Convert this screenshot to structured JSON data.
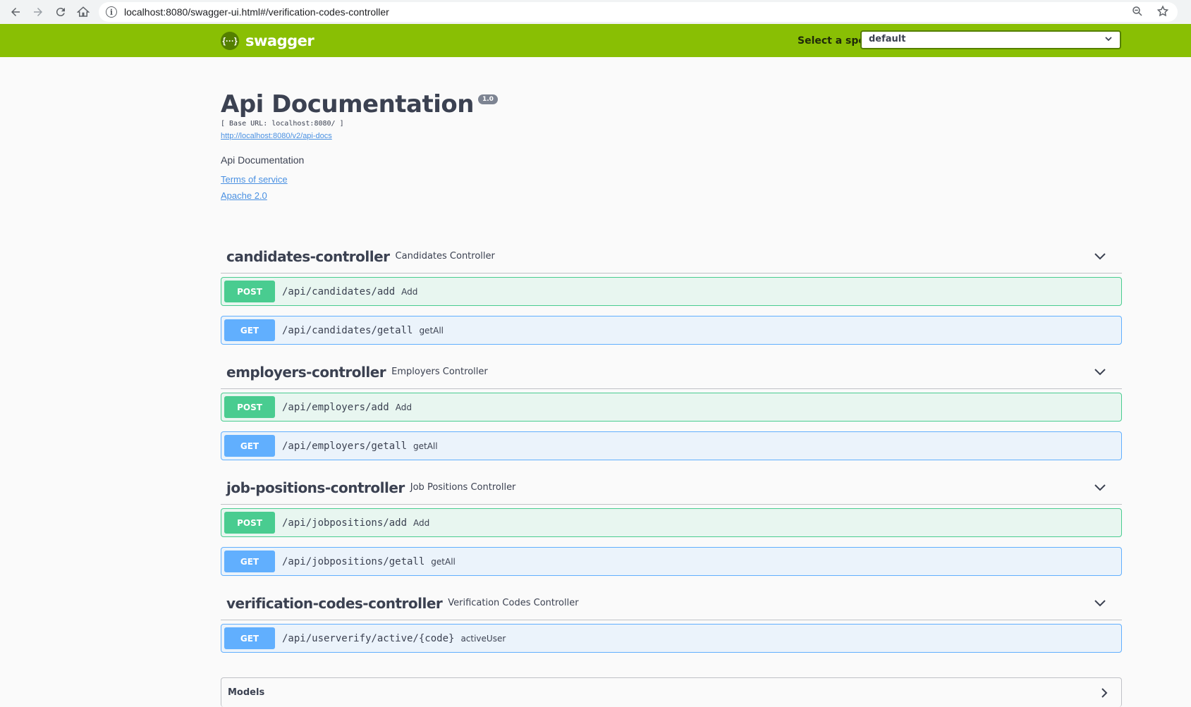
{
  "browser": {
    "url": "localhost:8080/swagger-ui.html#/verification-codes-controller"
  },
  "topbar": {
    "logo_text": "swagger",
    "logo_glyph": "{···}",
    "spec_label": "Select a spec",
    "spec_value": "default"
  },
  "info": {
    "title": "Api Documentation",
    "version": "1.0",
    "base_url": "[ Base URL: localhost:8080/ ]",
    "docs_url": "http://localhost:8080/v2/api-docs",
    "description": "Api Documentation",
    "terms": "Terms of service",
    "license": "Apache 2.0"
  },
  "sections": [
    {
      "name": "candidates-controller",
      "desc": "Candidates Controller",
      "ops": [
        {
          "method": "POST",
          "path": "/api/candidates/add",
          "summary": "Add"
        },
        {
          "method": "GET",
          "path": "/api/candidates/getall",
          "summary": "getAll"
        }
      ]
    },
    {
      "name": "employers-controller",
      "desc": "Employers Controller",
      "ops": [
        {
          "method": "POST",
          "path": "/api/employers/add",
          "summary": "Add"
        },
        {
          "method": "GET",
          "path": "/api/employers/getall",
          "summary": "getAll"
        }
      ]
    },
    {
      "name": "job-positions-controller",
      "desc": "Job Positions Controller",
      "ops": [
        {
          "method": "POST",
          "path": "/api/jobpositions/add",
          "summary": "Add"
        },
        {
          "method": "GET",
          "path": "/api/jobpositions/getall",
          "summary": "getAll"
        }
      ]
    },
    {
      "name": "verification-codes-controller",
      "desc": "Verification Codes Controller",
      "ops": [
        {
          "method": "GET",
          "path": "/api/userverify/active/{code}",
          "summary": "activeUser"
        }
      ]
    }
  ],
  "models": {
    "label": "Models"
  },
  "colors": {
    "topbar": "#89bf04",
    "post": "#49cc90",
    "get": "#61affe",
    "link": "#4990e2"
  }
}
